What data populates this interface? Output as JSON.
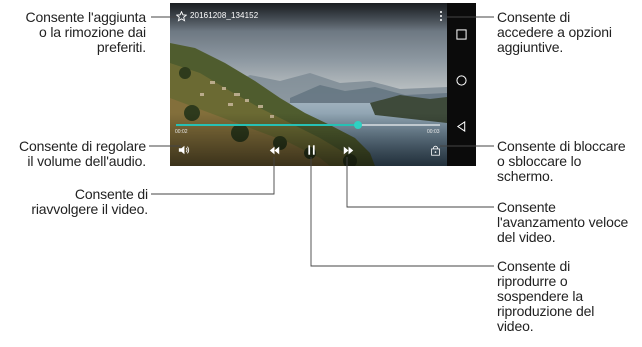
{
  "video": {
    "filename": "20161208_134152",
    "elapsed": "00:02",
    "duration": "00:03",
    "progress_fraction": 0.69,
    "accent_color": "#27c0b4"
  },
  "icons": {
    "favorite": "star-icon",
    "more_options": "more-vertical-icon",
    "volume": "speaker-icon",
    "rewind": "rewind-icon",
    "play_pause": "pause-icon",
    "fast_forward": "fast-forward-icon",
    "screen_lock": "lock-screen-icon",
    "nav_recents": "square-icon",
    "nav_home": "circle-icon",
    "nav_back": "triangle-back-icon"
  },
  "callouts": {
    "favorites": "Consente l'aggiunta\no la rimozione dai\npreferiti.",
    "volume": "Consente di regolare\nil volume dell'audio.",
    "rewind": "Consente di\nriavvolgere il video.",
    "options": "Consente di\naccedere a opzioni\naggiuntive.",
    "lock": "Consente di bloccare\no sbloccare lo\nschermo.",
    "fast_forward": "Consente\nl'avanzamento veloce\ndel video.",
    "play_pause": "Consente di\nriprodurre o\nsospendere la\nriproduzione del\nvideo."
  }
}
